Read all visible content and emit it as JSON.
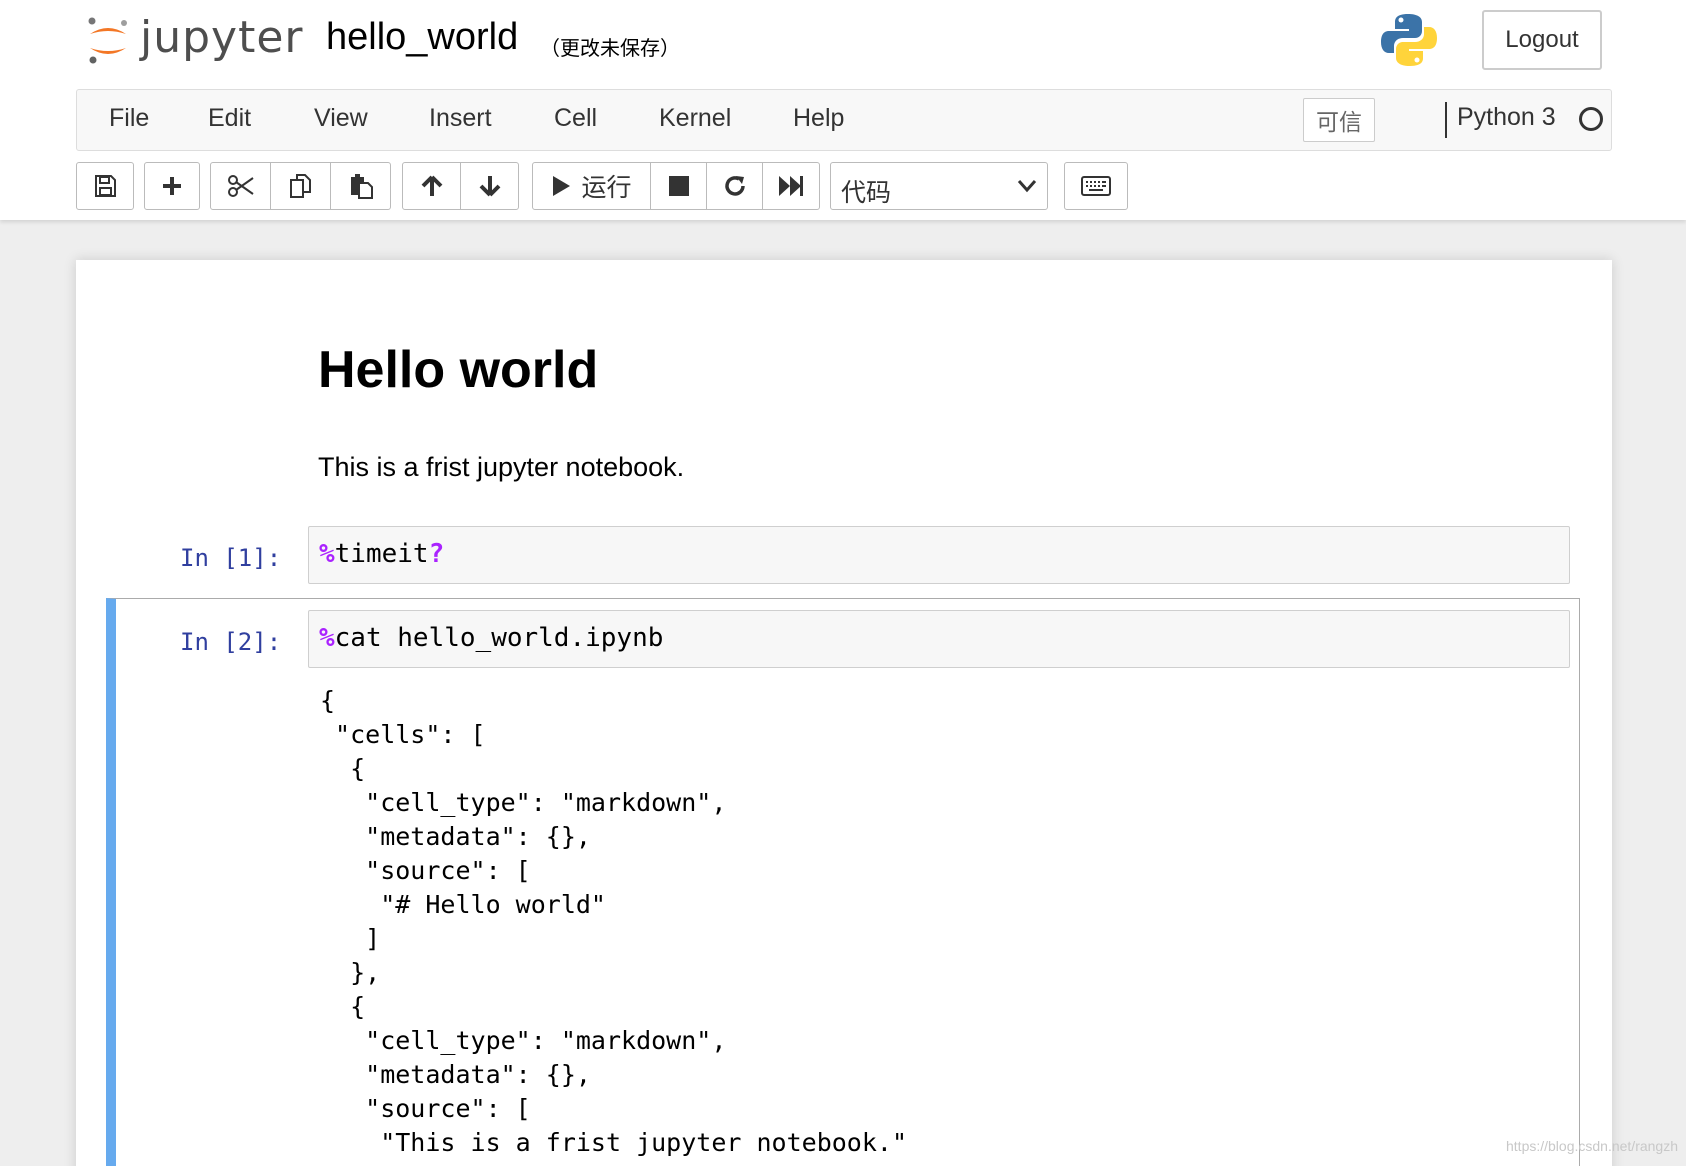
{
  "header": {
    "logo_text": "jupyter",
    "notebook_name": "hello_world",
    "save_status": "（更改未保存）",
    "logout_label": "Logout"
  },
  "menubar": {
    "items": [
      "File",
      "Edit",
      "View",
      "Insert",
      "Cell",
      "Kernel",
      "Help"
    ],
    "trusted_label": "可信",
    "kernel_name": "Python 3"
  },
  "toolbar": {
    "run_label": "运行",
    "cell_type": "代码"
  },
  "cells": {
    "markdown": {
      "heading": "Hello world",
      "paragraph": "This is a frist jupyter notebook."
    },
    "code1": {
      "prompt": "In [1]:",
      "magic": "%",
      "code": "timeit",
      "suffix": "?"
    },
    "code2": {
      "prompt": "In [2]:",
      "magic": "%",
      "code": "cat hello_world.ipynb",
      "output": "{\n \"cells\": [\n  {\n   \"cell_type\": \"markdown\",\n   \"metadata\": {},\n   \"source\": [\n    \"# Hello world\"\n   ]\n  },\n  {\n   \"cell_type\": \"markdown\",\n   \"metadata\": {},\n   \"source\": [\n    \"This is a frist jupyter notebook.\""
    }
  },
  "watermark": "https://blog.csdn.net/rangzh",
  "colors": {
    "accent": "#66aaee",
    "prompt": "#303f9f",
    "magic": "#aa22ff",
    "jupyter_orange": "#f37726"
  }
}
